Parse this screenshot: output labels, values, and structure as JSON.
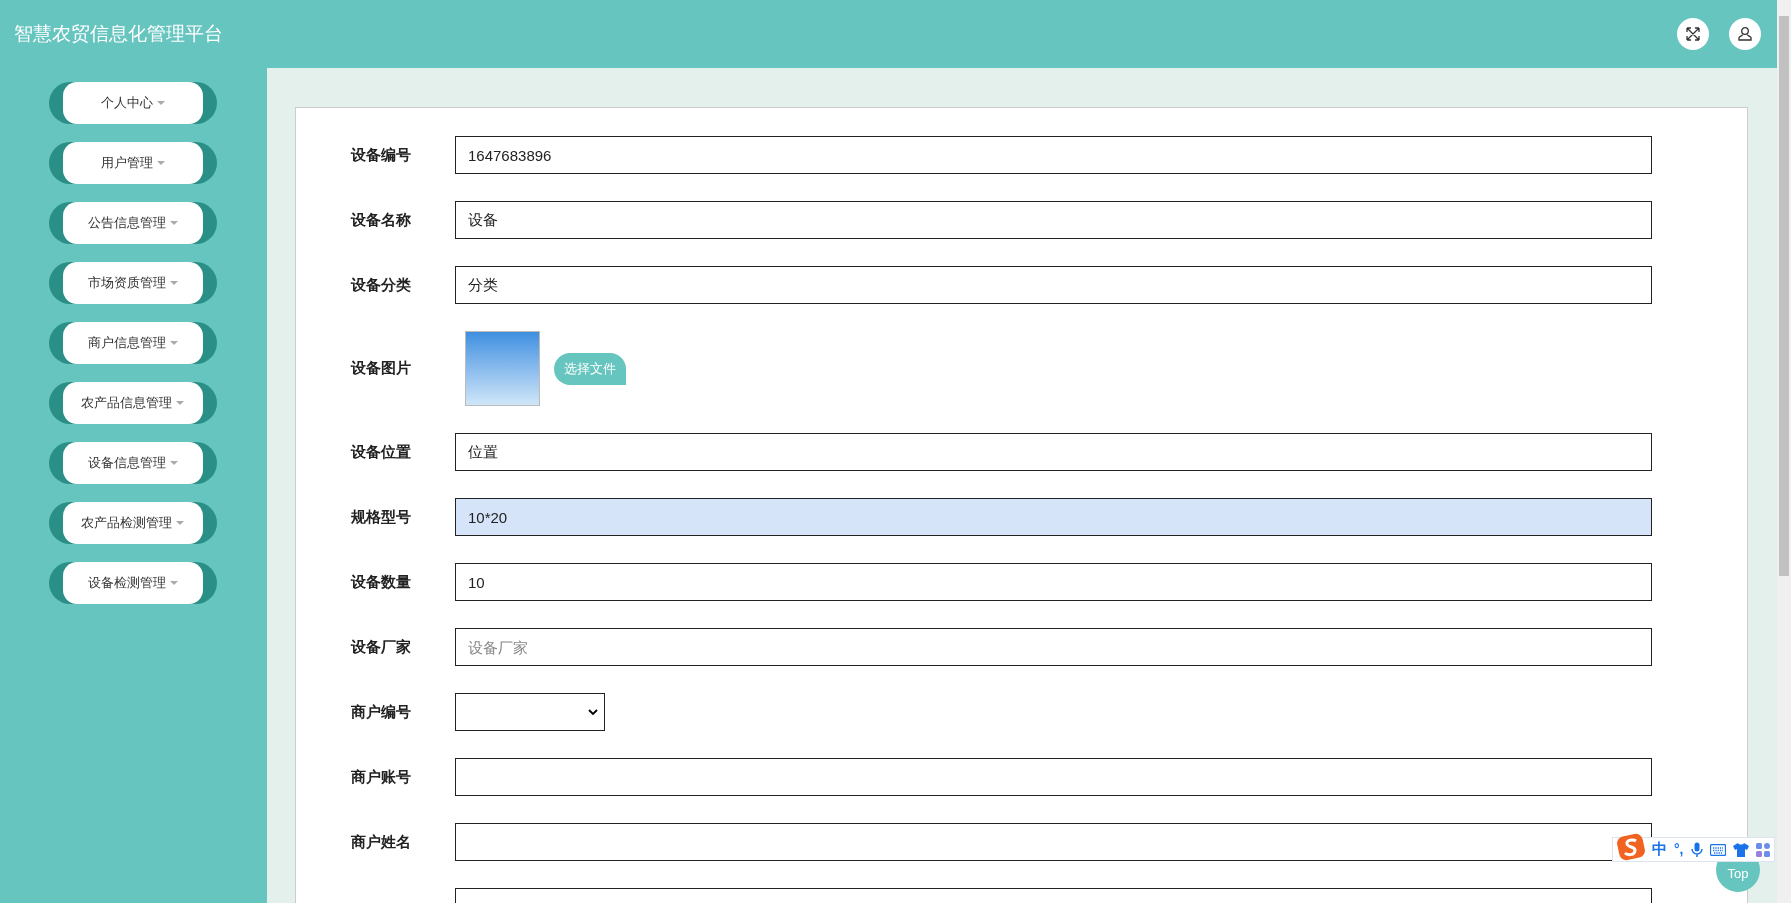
{
  "header": {
    "title": "智慧农贸信息化管理平台"
  },
  "sidebar": {
    "items": [
      {
        "label": "个人中心"
      },
      {
        "label": "用户管理"
      },
      {
        "label": "公告信息管理"
      },
      {
        "label": "市场资质管理"
      },
      {
        "label": "商户信息管理"
      },
      {
        "label": "农产品信息管理"
      },
      {
        "label": "设备信息管理"
      },
      {
        "label": "农产品检测管理"
      },
      {
        "label": "设备检测管理"
      }
    ]
  },
  "form": {
    "rows": [
      {
        "kind": "input",
        "label": "设备编号",
        "value": "1647683896",
        "highlighted": false
      },
      {
        "kind": "input",
        "label": "设备名称",
        "value": "设备",
        "highlighted": false
      },
      {
        "kind": "input",
        "label": "设备分类",
        "value": "分类",
        "highlighted": false
      },
      {
        "kind": "image",
        "label": "设备图片",
        "button": "选择文件"
      },
      {
        "kind": "input",
        "label": "设备位置",
        "value": "位置",
        "highlighted": false
      },
      {
        "kind": "input",
        "label": "规格型号",
        "value": "10*20",
        "highlighted": true
      },
      {
        "kind": "input",
        "label": "设备数量",
        "value": "10",
        "highlighted": false
      },
      {
        "kind": "input",
        "label": "设备厂家",
        "placeholder": "设备厂家",
        "highlighted": false
      },
      {
        "kind": "select",
        "label": "商户编号"
      },
      {
        "kind": "input",
        "label": "商户账号",
        "highlighted": false
      },
      {
        "kind": "input",
        "label": "商户姓名",
        "highlighted": false
      },
      {
        "kind": "input",
        "highlighted": false
      }
    ]
  },
  "back_to_top": "Top",
  "ime_toolbar": {
    "mode": "中",
    "punctuation": "°,"
  }
}
